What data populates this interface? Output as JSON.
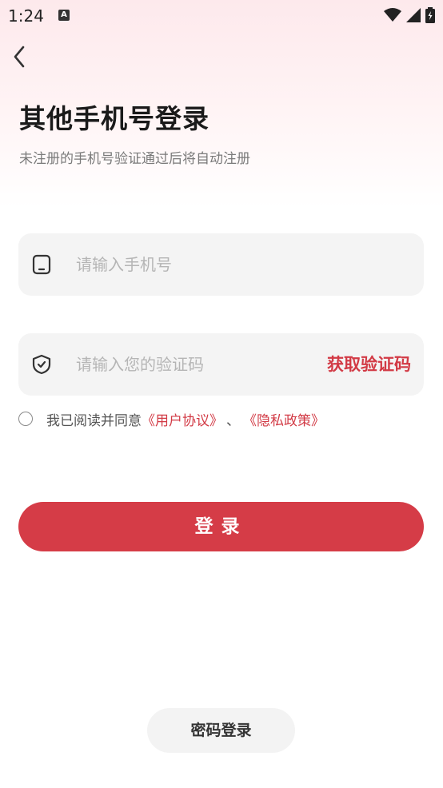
{
  "status_bar": {
    "time": "1:24",
    "notification_icon": "A"
  },
  "header": {
    "back_icon": "chevron-left-icon"
  },
  "title": "其他手机号登录",
  "subtitle": "未注册的手机号验证通过后将自动注册",
  "phone_field": {
    "placeholder": "请输入手机号",
    "value": "",
    "icon": "phone-icon"
  },
  "code_field": {
    "placeholder": "请输入您的验证码",
    "value": "",
    "icon": "shield-check-icon",
    "get_code_label": "获取验证码"
  },
  "agreement": {
    "prefix": "我已阅读并同意",
    "user_agreement": "《用户协议》",
    "separator": "、",
    "privacy_policy": "《隐私政策》",
    "checked": false
  },
  "login_button_label": "登录",
  "password_login_label": "密码登录",
  "colors": {
    "accent": "#d53c47",
    "link": "#d23a45",
    "field_bg": "#f4f4f4"
  }
}
